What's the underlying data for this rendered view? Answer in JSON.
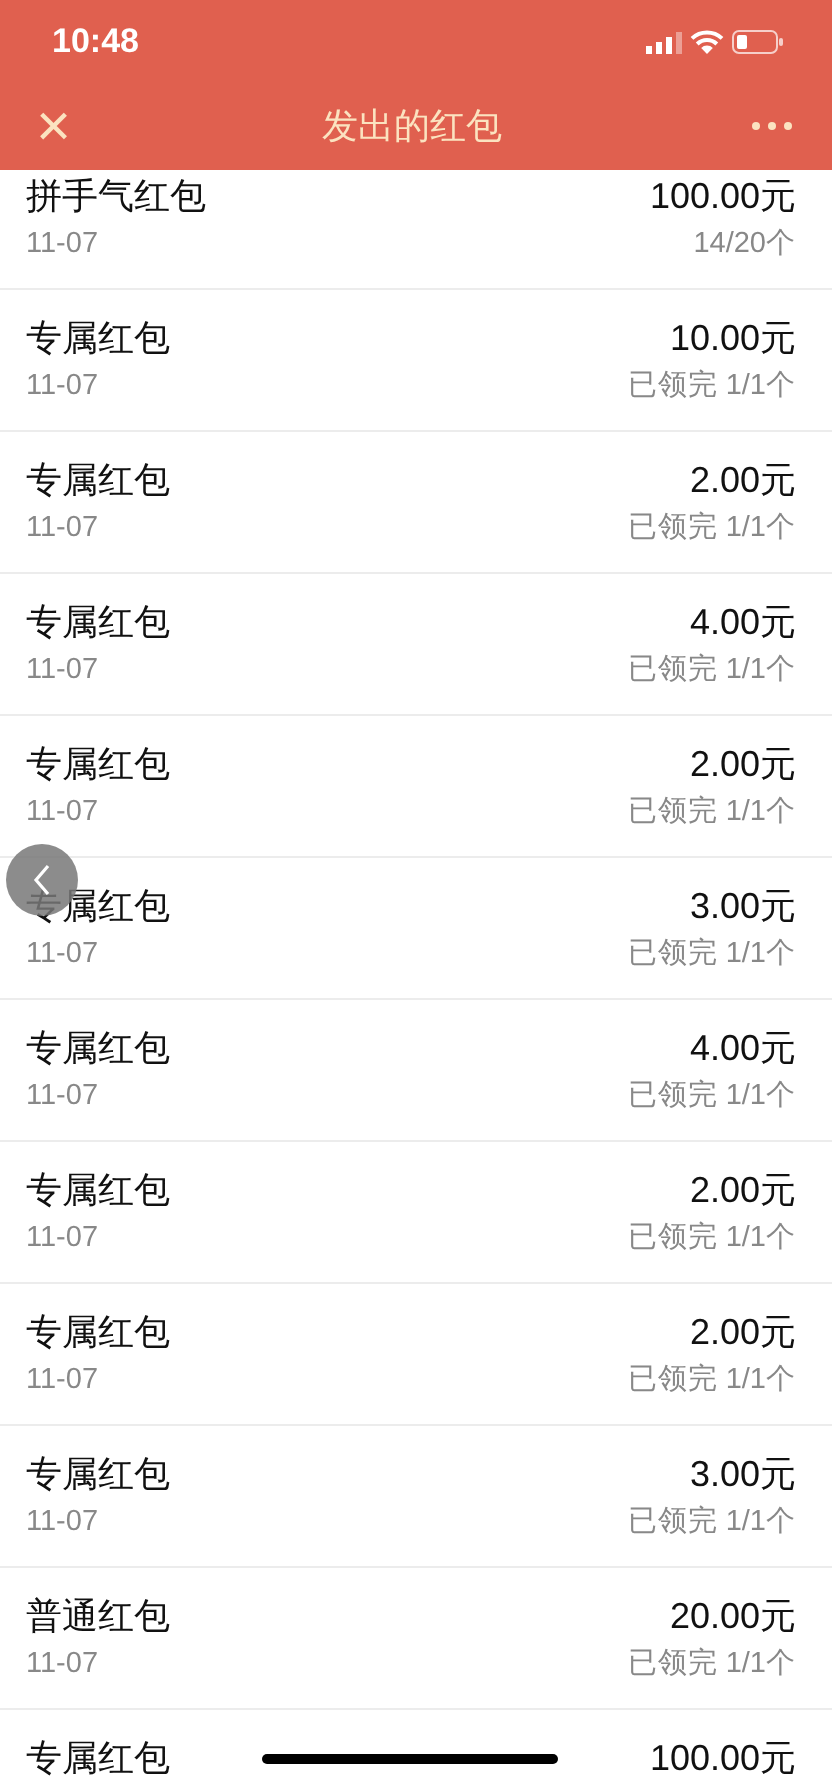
{
  "status_bar": {
    "time": "10:48"
  },
  "nav": {
    "title": "发出的红包",
    "close": "×"
  },
  "packets": [
    {
      "name": "拼手气红包",
      "amount": "100.00元",
      "date": "11-07",
      "status": "14/20个"
    },
    {
      "name": "专属红包",
      "amount": "10.00元",
      "date": "11-07",
      "status": "已领完 1/1个"
    },
    {
      "name": "专属红包",
      "amount": "2.00元",
      "date": "11-07",
      "status": "已领完 1/1个"
    },
    {
      "name": "专属红包",
      "amount": "4.00元",
      "date": "11-07",
      "status": "已领完 1/1个"
    },
    {
      "name": "专属红包",
      "amount": "2.00元",
      "date": "11-07",
      "status": "已领完 1/1个"
    },
    {
      "name": "专属红包",
      "amount": "3.00元",
      "date": "11-07",
      "status": "已领完 1/1个"
    },
    {
      "name": "专属红包",
      "amount": "4.00元",
      "date": "11-07",
      "status": "已领完 1/1个"
    },
    {
      "name": "专属红包",
      "amount": "2.00元",
      "date": "11-07",
      "status": "已领完 1/1个"
    },
    {
      "name": "专属红包",
      "amount": "2.00元",
      "date": "11-07",
      "status": "已领完 1/1个"
    },
    {
      "name": "专属红包",
      "amount": "3.00元",
      "date": "11-07",
      "status": "已领完 1/1个"
    },
    {
      "name": "普通红包",
      "amount": "20.00元",
      "date": "11-07",
      "status": "已领完 1/1个"
    },
    {
      "name": "专属红包",
      "amount": "100.00元"
    }
  ]
}
